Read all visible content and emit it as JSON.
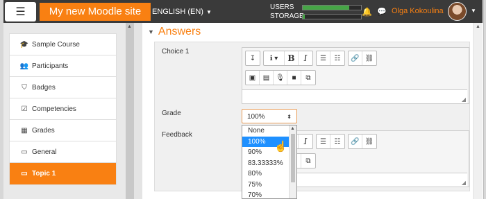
{
  "navbar": {
    "site_name": "My new Moodle site",
    "language": "ENGLISH (EN)",
    "usage": [
      {
        "label": "USERS",
        "fraction": 0.8
      },
      {
        "label": "STORAGE",
        "fraction": 0.03
      }
    ],
    "user_name": "Olga Kokoulina"
  },
  "sidebar": {
    "items": [
      {
        "label": "Sample Course",
        "icon": "graduation-cap-icon",
        "glyph": "🎓"
      },
      {
        "label": "Participants",
        "icon": "users-icon",
        "glyph": "👥"
      },
      {
        "label": "Badges",
        "icon": "shield-icon",
        "glyph": "⛉"
      },
      {
        "label": "Competencies",
        "icon": "checkbox-icon",
        "glyph": "☑"
      },
      {
        "label": "Grades",
        "icon": "table-icon",
        "glyph": "▦"
      },
      {
        "label": "General",
        "icon": "folder-icon",
        "glyph": "▭"
      },
      {
        "label": "Topic 1",
        "icon": "folder-icon",
        "glyph": "▭",
        "active": true
      }
    ]
  },
  "section": {
    "title": "Answers"
  },
  "form": {
    "choice_label": "Choice 1",
    "grade_label": "Grade",
    "feedback_label": "Feedback",
    "grade_value": "100%",
    "grade_options": [
      "None",
      "100%",
      "90%",
      "83.33333%",
      "80%",
      "75%",
      "70%"
    ],
    "selected_option": "100%"
  },
  "colors": {
    "accent": "#f98012",
    "navbar": "#3a3a3a",
    "selection": "#1e90ff"
  }
}
